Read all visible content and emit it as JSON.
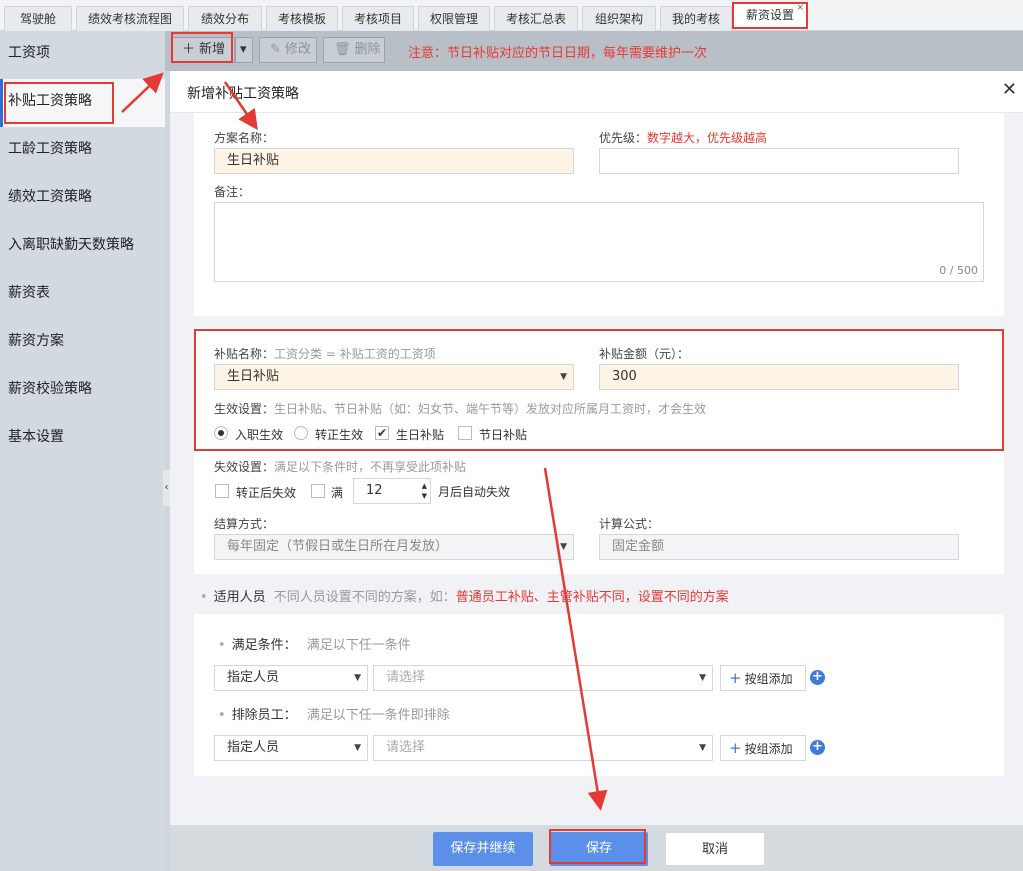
{
  "tabs": [
    {
      "label": "驾驶舱"
    },
    {
      "label": "绩效考核流程图"
    },
    {
      "label": "绩效分布"
    },
    {
      "label": "考核模板"
    },
    {
      "label": "考核项目"
    },
    {
      "label": "权限管理"
    },
    {
      "label": "考核汇总表"
    },
    {
      "label": "组织架构"
    },
    {
      "label": "我的考核"
    },
    {
      "label": "薪资设置",
      "close": "×"
    }
  ],
  "sidebar": {
    "items": [
      {
        "label": "工资项"
      },
      {
        "label": "补贴工资策略"
      },
      {
        "label": "工龄工资策略"
      },
      {
        "label": "绩效工资策略"
      },
      {
        "label": "入离职缺勤天数策略"
      },
      {
        "label": "薪资表"
      },
      {
        "label": "薪资方案"
      },
      {
        "label": "薪资校验策略"
      },
      {
        "label": "基本设置"
      }
    ],
    "collapse_icon": "‹"
  },
  "toolbar": {
    "add_label": "新增",
    "dropdown_icon": "▾",
    "edit_label": "修改",
    "delete_label": "删除",
    "notice": "注意：节日补贴对应的节日日期，每年需要维护一次"
  },
  "drawer": {
    "title": "新增补贴工资策略",
    "close_icon": "✕"
  },
  "form": {
    "scheme_name_label": "方案名称：",
    "scheme_name_value": "生日补贴",
    "priority_label": "优先级：",
    "priority_hint": "数字越大，优先级越高",
    "priority_value": "",
    "remark_label": "备注：",
    "remark_counter": "0 / 500",
    "subsidy_name_label": "补贴名称：",
    "subsidy_name_hint": "工资分类 = 补贴工资的工资项",
    "subsidy_name_value": "生日补贴",
    "subsidy_amount_label": "补贴金额（元）：",
    "subsidy_amount_value": "300",
    "effective_label": "生效设置：",
    "effective_hint": "生日补贴、节日补贴（如：妇女节、端午节等）发放对应所属月工资时，才会生效",
    "effective_options": [
      {
        "label": "入职生效",
        "checked": true
      },
      {
        "label": "转正生效",
        "checked": false
      },
      {
        "label": "生日补贴",
        "checked": true
      },
      {
        "label": "节日补贴",
        "checked": false
      }
    ],
    "invalid_label": "失效设置：",
    "invalid_hint": "满足以下条件时，不再享受此项补贴",
    "invalid_after_regular": "转正后失效",
    "invalid_full": "满",
    "invalid_months": "12",
    "invalid_suffix": "月后自动失效",
    "settle_label": "结算方式：",
    "settle_value": "每年固定（节假日或生日所在月发放）",
    "formula_label": "计算公式：",
    "formula_value": "固定金额"
  },
  "applicable": {
    "title": "适用人员",
    "hint": "不同人员设置不同的方案，如：",
    "hint_red": "普通员工补贴、主管补贴不同，设置不同的方案",
    "meet_label": "满足条件：",
    "meet_hint": "满足以下任一条件",
    "exclude_label": "排除员工：",
    "exclude_hint": "满足以下任一条件即排除",
    "type_value": "指定人员",
    "select_placeholder": "请选择",
    "group_add_label": "按组添加"
  },
  "footer": {
    "save_continue": "保存并继续",
    "save": "保存",
    "cancel": "取消"
  },
  "colors": {
    "highlight": "#e53935",
    "primary": "#5b8fe8",
    "accent": "#2f6fd6"
  }
}
